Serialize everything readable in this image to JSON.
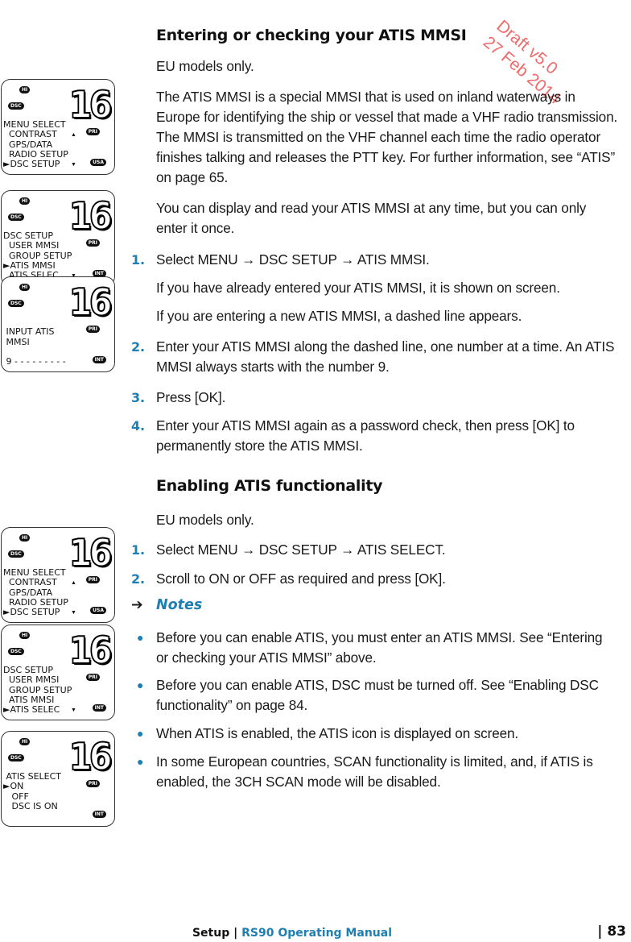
{
  "watermark": {
    "line1": "Draft v5.0",
    "line2": "27 Feb 2014"
  },
  "section1": {
    "heading": "Entering or checking your ATIS MMSI",
    "eu_note": "EU models only.",
    "intro": "The ATIS MMSI is a special MMSI that is used on inland waterways in Europe for identifying the ship or vessel that made a VHF radio transmission.  The MMSI is transmitted on the VHF channel each time the radio operator finishes talking and releases the PTT key. For further information, see “ATIS” on page 65.",
    "display_note": "You can display and read your ATIS MMSI at any time, but you can only enter it once.",
    "steps": [
      {
        "num": "1.",
        "text": "Select MENU →  DSC SETUP → ATIS MMSI."
      },
      {
        "num": "2.",
        "text": "Enter your ATIS MMSI along the dashed line, one number at a time. An ATIS MMSI always starts with the number 9."
      },
      {
        "num": "3.",
        "text": "Press [OK]."
      },
      {
        "num": "4.",
        "text": "Enter your ATIS MMSI again as a password check, then press [OK] to permanently store the ATIS MMSI."
      }
    ],
    "step1_sub1": "If you have already entered your ATIS MMSI, it is shown on screen.",
    "step1_sub2": "If you are entering a new ATIS MMSI, a dashed line appears."
  },
  "section2": {
    "heading": "Enabling ATIS functionality",
    "eu_note": "EU models only.",
    "steps": [
      {
        "num": "1.",
        "text": "Select MENU → DSC SETUP → ATIS SELECT."
      },
      {
        "num": "2.",
        "text": "Scroll to ON or OFF as required and press [OK]."
      }
    ],
    "notes_label": "Notes",
    "notes_arrow": "➔",
    "notes": [
      "Before you can enable ATIS, you must enter an ATIS MMSI. See “Entering or checking your ATIS MMSI” above.",
      "Before you can enable ATIS, DSC must be turned off. See “Enabling DSC functionality” on page 84.",
      "When ATIS is enabled, the ATIS icon is displayed on screen.",
      "In some European countries, SCAN functionality is limited, and, if ATIS is enabled, the 3CH SCAN mode will be disabled."
    ]
  },
  "displays": [
    {
      "channel": "16",
      "badges": {
        "power": "HI",
        "mode": "DSC",
        "priority": "PRI",
        "region": "USA"
      },
      "lines": [
        "MENU SELECT",
        "  CONTRAST",
        "  GPS/DATA",
        "  RADIO SETUP",
        "►DSC SETUP"
      ]
    },
    {
      "channel": "16",
      "badges": {
        "power": "HI",
        "mode": "DSC",
        "priority": "PRI",
        "region": "INT"
      },
      "lines": [
        "DSC SETUP",
        "  USER MMSI",
        "  GROUP SETUP",
        "►ATIS MMSI",
        "  ATIS SELEC"
      ]
    },
    {
      "channel": "16",
      "badges": {
        "power": "HI",
        "mode": "DSC",
        "priority": "PRI",
        "region": "INT"
      },
      "lines": [
        "",
        " INPUT ATIS",
        " MMSI",
        "",
        " 9 - - - - - - - - -"
      ]
    },
    {
      "channel": "16",
      "badges": {
        "power": "HI",
        "mode": "DSC",
        "priority": "PRI",
        "region": "USA"
      },
      "lines": [
        "MENU SELECT",
        "  CONTRAST",
        "  GPS/DATA",
        "  RADIO SETUP",
        "►DSC SETUP"
      ]
    },
    {
      "channel": "16",
      "badges": {
        "power": "HI",
        "mode": "DSC",
        "priority": "PRI",
        "region": "INT"
      },
      "lines": [
        "DSC SETUP",
        "  USER MMSI",
        "  GROUP SETUP",
        "  ATIS MMSI",
        "►ATIS SELEC"
      ]
    },
    {
      "channel": "16",
      "badges": {
        "power": "HI",
        "mode": "DSC",
        "priority": "PRI",
        "region": "INT"
      },
      "lines": [
        " ATIS SELECT",
        "►ON",
        "   OFF",
        "   DSC IS ON",
        ""
      ]
    }
  ],
  "scroll_arrows": {
    "up": "▲",
    "down": "▼"
  },
  "footer": {
    "section": "Setup",
    "separator": "|",
    "manual": "RS90 Operating Manual",
    "page": "| 83"
  }
}
